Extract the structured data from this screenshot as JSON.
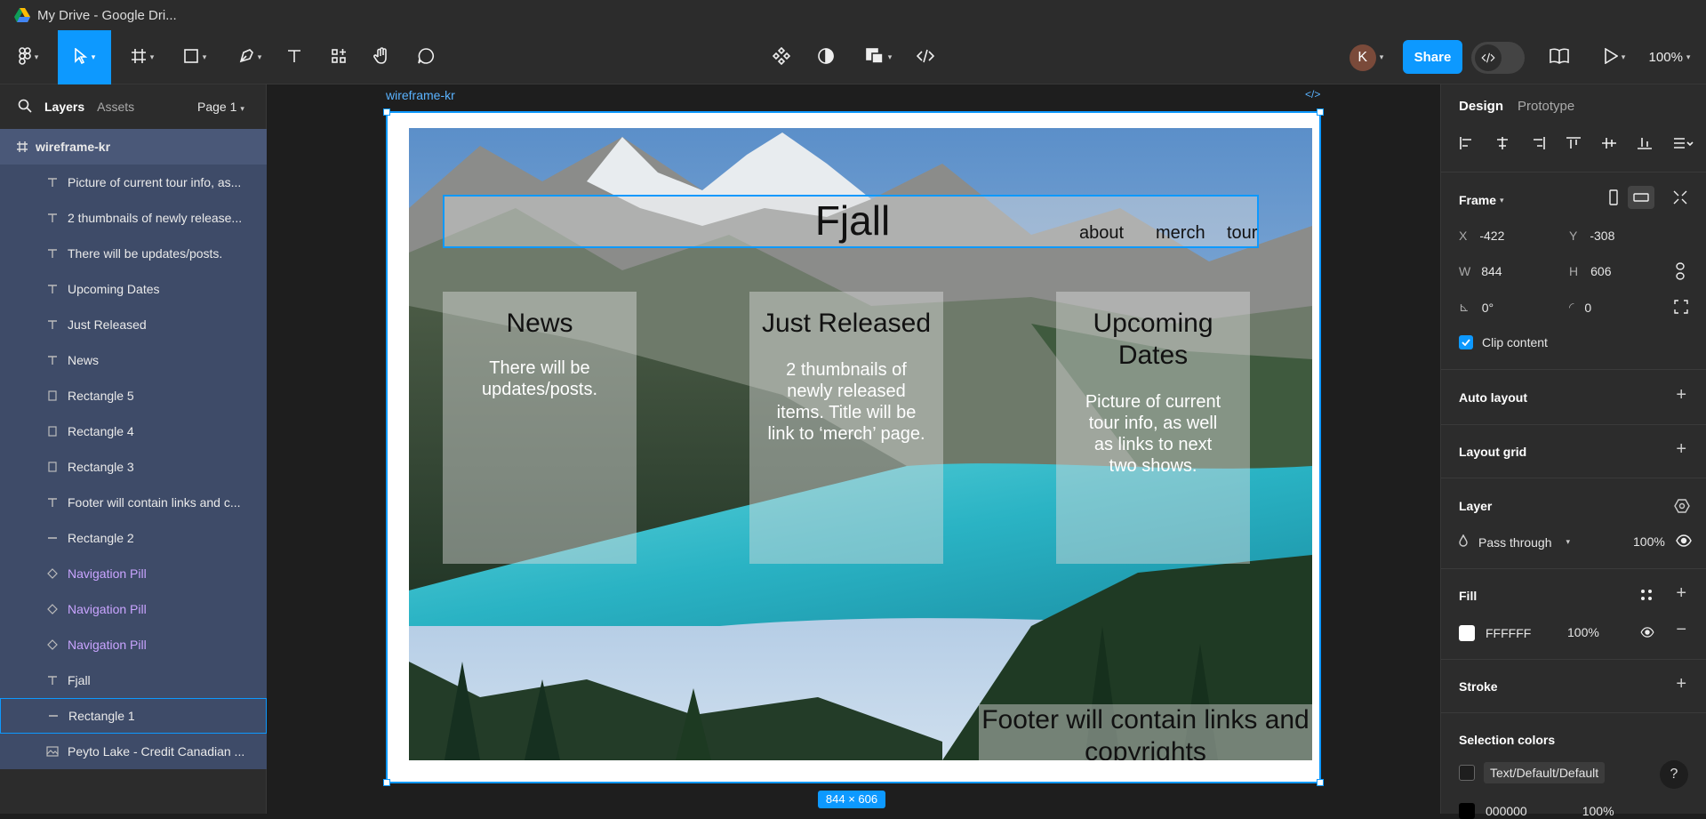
{
  "window": {
    "title": "My Drive - Google Dri..."
  },
  "toolbar": {
    "share_label": "Share",
    "zoom": "100%",
    "avatar_letter": "K"
  },
  "left_panel": {
    "tabs": [
      "Layers",
      "Assets"
    ],
    "page": "Page 1",
    "layers": [
      {
        "label": "wireframe-kr",
        "icon": "frame-icon",
        "kind": "frame"
      },
      {
        "label": "Picture of current tour info, as...",
        "icon": "text-icon",
        "kind": "child"
      },
      {
        "label": "2 thumbnails of newly release...",
        "icon": "text-icon",
        "kind": "child"
      },
      {
        "label": "There will be updates/posts.",
        "icon": "text-icon",
        "kind": "child"
      },
      {
        "label": "Upcoming Dates",
        "icon": "text-icon",
        "kind": "child"
      },
      {
        "label": "Just Released",
        "icon": "text-icon",
        "kind": "child"
      },
      {
        "label": "News",
        "icon": "text-icon",
        "kind": "child"
      },
      {
        "label": "Rectangle 5",
        "icon": "rectangle-icon",
        "kind": "child"
      },
      {
        "label": "Rectangle 4",
        "icon": "rectangle-icon",
        "kind": "child"
      },
      {
        "label": "Rectangle 3",
        "icon": "rectangle-icon",
        "kind": "child"
      },
      {
        "label": "Footer will contain links and c...",
        "icon": "text-icon",
        "kind": "child"
      },
      {
        "label": "Rectangle 2",
        "icon": "line-icon",
        "kind": "child"
      },
      {
        "label": "Navigation Pill",
        "icon": "component-icon",
        "kind": "comp"
      },
      {
        "label": "Navigation Pill",
        "icon": "component-icon",
        "kind": "comp"
      },
      {
        "label": "Navigation Pill",
        "icon": "component-icon",
        "kind": "comp"
      },
      {
        "label": "Fjall",
        "icon": "text-icon",
        "kind": "child"
      },
      {
        "label": "Rectangle 1",
        "icon": "line-icon",
        "kind": "selected"
      },
      {
        "label": "Peyto Lake - Credit Canadian ...",
        "icon": "image-icon",
        "kind": "child"
      }
    ]
  },
  "canvas": {
    "frame_name": "wireframe-kr",
    "size_badge": "844 × 606",
    "site_title": "Fjall",
    "nav": [
      "about",
      "merch",
      "tour"
    ],
    "cards": [
      {
        "heading": "News",
        "body": "There will be updates/posts."
      },
      {
        "heading": "Just Released",
        "body": "2 thumbnails of newly released items. Title will be link to ‘merch’ page."
      },
      {
        "heading": "Upcoming Dates",
        "body": "Picture of current tour info, as well as links to next two shows."
      }
    ],
    "footer": "Footer will contain links and copyrights"
  },
  "right_panel": {
    "tabs": [
      "Design",
      "Prototype"
    ],
    "frame_label": "Frame",
    "x": "-422",
    "y": "-308",
    "w": "844",
    "h": "606",
    "rotation": "0°",
    "radius": "0",
    "clip_content": "Clip content",
    "auto_layout": "Auto layout",
    "layout_grid": "Layout grid",
    "layer_label": "Layer",
    "blend_mode": "Pass through",
    "opacity": "100%",
    "fill_label": "Fill",
    "fill_hex": "FFFFFF",
    "fill_opacity": "100%",
    "stroke_label": "Stroke",
    "selection_colors": "Selection colors",
    "sel_color_1": "Text/Default/Default",
    "sel_color_2_hex": "000000",
    "sel_color_2_opacity": "100%"
  },
  "colors": {
    "accent": "#0d99ff",
    "panel": "#2c2c2c",
    "layer_highlight": "#3e4b68",
    "component": "#c9a4ff"
  }
}
